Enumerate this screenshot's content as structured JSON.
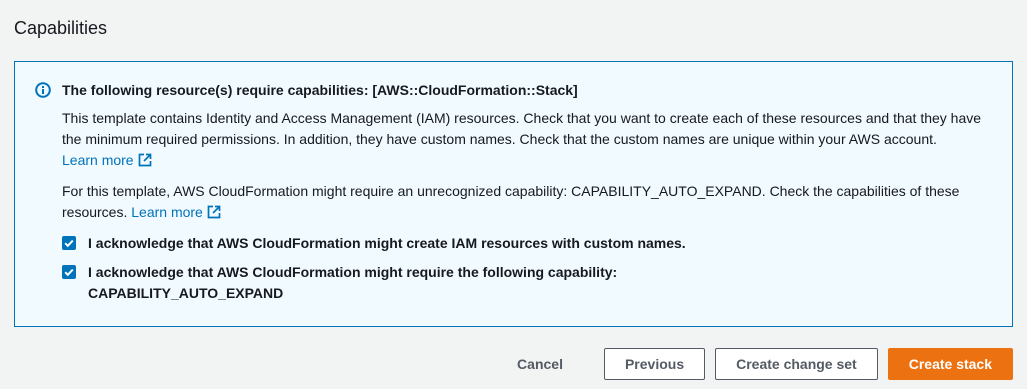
{
  "section": {
    "title": "Capabilities"
  },
  "alert": {
    "icon": "info-icon",
    "heading": "The following resource(s) require capabilities: [AWS::CloudFormation::Stack]",
    "paragraph1": "This template contains Identity and Access Management (IAM) resources. Check that you want to create each of these resources and that they have the minimum required permissions. In addition, they have custom names. Check that the custom names are unique within your AWS account.",
    "paragraph1_link": "Learn more",
    "paragraph2": "For this template, AWS CloudFormation might require an unrecognized capability: CAPABILITY_AUTO_EXPAND. Check the capabilities of these resources.",
    "paragraph2_link": "Learn more",
    "acknowledgements": [
      {
        "label": "I acknowledge that AWS CloudFormation might create IAM resources with custom names.",
        "checked": true
      },
      {
        "label": "I acknowledge that AWS CloudFormation might require the following capability: CAPABILITY_AUTO_EXPAND",
        "checked": true
      }
    ]
  },
  "actions": {
    "cancel": "Cancel",
    "previous": "Previous",
    "create_change_set": "Create change set",
    "create_stack": "Create stack"
  },
  "colors": {
    "link": "#0073bb",
    "alert_border": "#0073bb",
    "alert_background": "#f1faff",
    "primary_button": "#ec7211",
    "page_background": "#f2f3f3"
  }
}
